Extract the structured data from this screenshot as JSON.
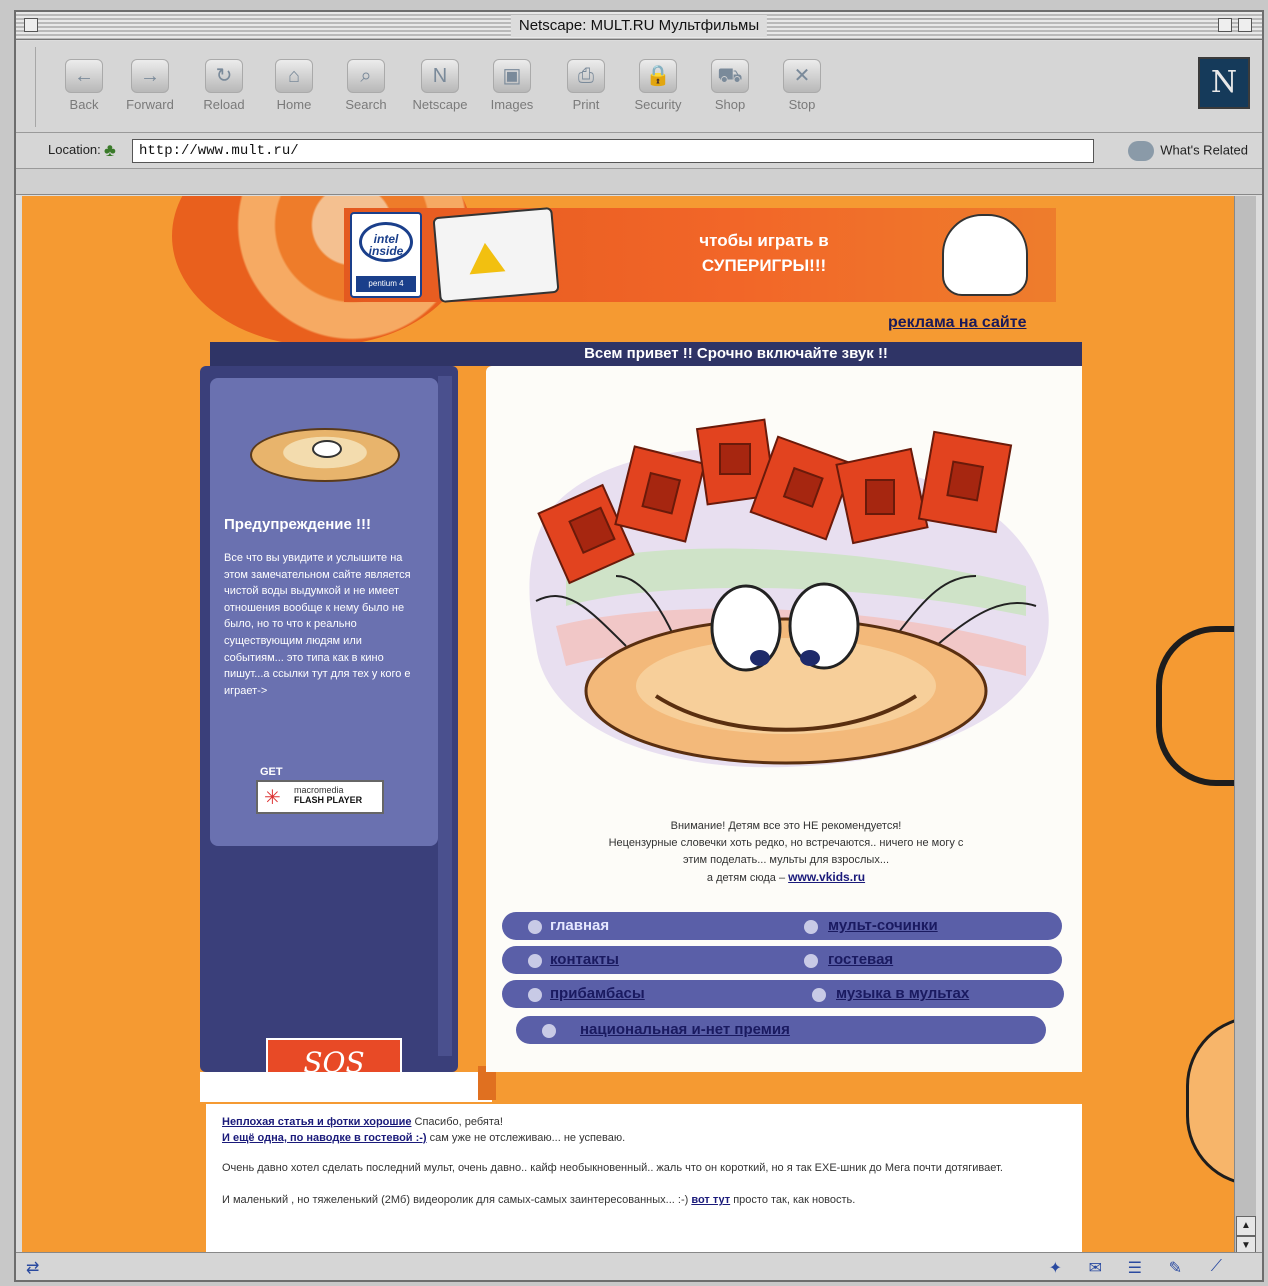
{
  "window": {
    "title": "Netscape: MULT.RU Мультфильмы"
  },
  "toolbar": {
    "buttons": [
      {
        "label": "Back",
        "icon": "back-arrow-icon"
      },
      {
        "label": "Forward",
        "icon": "forward-arrow-icon"
      },
      {
        "label": "Reload",
        "icon": "reload-icon"
      },
      {
        "label": "Home",
        "icon": "home-icon"
      },
      {
        "label": "Search",
        "icon": "search-icon"
      },
      {
        "label": "Netscape",
        "icon": "netscape-icon"
      },
      {
        "label": "Images",
        "icon": "images-icon"
      },
      {
        "label": "Print",
        "icon": "print-icon"
      },
      {
        "label": "Security",
        "icon": "security-icon"
      },
      {
        "label": "Shop",
        "icon": "shop-icon"
      },
      {
        "label": "Stop",
        "icon": "stop-icon"
      }
    ],
    "logo": "N"
  },
  "location": {
    "label": "Location:",
    "url": "http://www.mult.ru/",
    "related": "What's Related"
  },
  "banner": {
    "intel_line1": "intel",
    "intel_line2": "inside",
    "intel_pentium": "pentium 4",
    "text_line1": "чтобы играть в",
    "text_line2": "СУПЕРИГРЫ!!!"
  },
  "page": {
    "ad_link": "реклама на сайте",
    "greeting": "Всем привет !! Срочно включайте звук !!",
    "warning_title": "Предупреждение !!!",
    "warning_text": "Все что вы увидите и услышите на этом замечательном сайте является чистой воды выдумкой и не имеет отношения вообще к нему было не было, но то что к реально существующим людям или событиям... это типа как в кино пишут...а ссылки тут для тех у кого е играет->",
    "flash_get": "GET",
    "flash_brand": "macromedia",
    "flash_name": "FLASH PLAYER",
    "sos_badge": "SOS",
    "notice_line1": "Внимание! Детям все это НЕ рекомендуется!",
    "notice_line2": "Нецензурные словечки хоть редко, но встречаются.. ничего не могу с",
    "notice_line3": "этим поделать... мульты для взрослых...",
    "notice_line4_prefix": "а детям сюда –",
    "notice_link": "www.vkids.ru",
    "nav": {
      "main": "главная",
      "cartoons": "мульт-сочинки",
      "contacts": "контакты",
      "guestbook": "гостевая",
      "extras": "прибамбасы",
      "music": "музыка в мультах",
      "award": "национальная и-нет премия"
    },
    "news": {
      "line1_link": "Неплохая статья и фотки хорошие",
      "line1_text": " Спасибо, ребята!",
      "line2_link": "И ещё одна, по наводке в гостевой :-)",
      "line2_text": " сам уже не отслеживаю... не успеваю.",
      "para2_text": "Очень давно хотел сделать последний мульт, очень давно.. кайф необыкновенный.. жаль что он короткий, но я так EXE-шник до Мега почти дотягивает.",
      "para3_text": "И маленький , но тяжеленький (2Мб) видеоролик для самых-самых заинтересованных... :-)",
      "para3_link": "вот тут",
      "para3_tail": " просто так, как новость."
    }
  },
  "colors": {
    "page_background": "#f59a32",
    "navy": "#2f3466",
    "panel_purple": "#6a71b0",
    "nav_pill": "#5a5fa8"
  }
}
